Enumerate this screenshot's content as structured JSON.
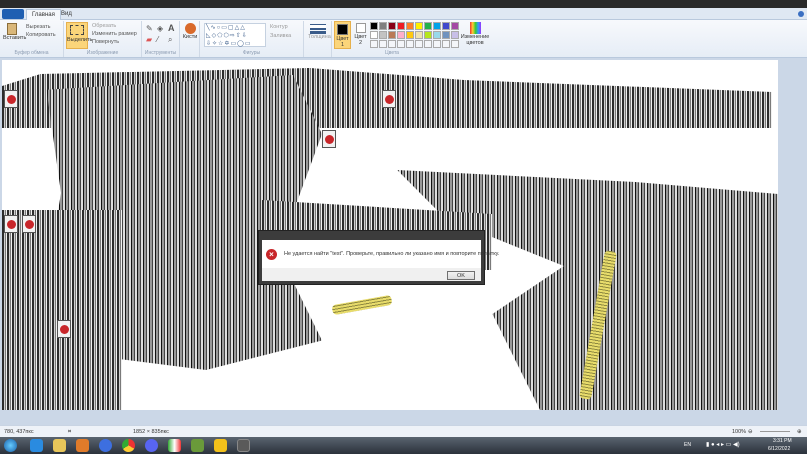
{
  "tabs": [
    "Главная",
    "Вид"
  ],
  "clipboard": {
    "paste": "Вставить",
    "cut": "Вырезать",
    "copy": "Копировать",
    "group": "Буфер обмена"
  },
  "image": {
    "select": "Выделить",
    "crop": "Обрезать",
    "resize": "Изменить размер",
    "rotate": "Повернуть",
    "group": "Изображение"
  },
  "tools": {
    "group": "Инструменты"
  },
  "brushes": {
    "label": "Кисти"
  },
  "shapes": {
    "outline": "Контур",
    "fill": "Заливка",
    "group": "Фигуры"
  },
  "size": {
    "label": "Толщина"
  },
  "colors": {
    "color1": "Цвет 1",
    "color2": "Цвет 2",
    "edit": "Изменение цветов",
    "group": "Цвета",
    "palette": [
      "#000000",
      "#7f7f7f",
      "#880015",
      "#ed1c24",
      "#ff7f27",
      "#fff200",
      "#22b14c",
      "#00a2e8",
      "#3f48cc",
      "#a349a4",
      "#ffffff",
      "#c3c3c3",
      "#b97a57",
      "#ffaec9",
      "#ffc90e",
      "#efe4b0",
      "#b5e61d",
      "#99d9ea",
      "#7092be",
      "#c8bfe7"
    ]
  },
  "dialog": {
    "message": "Не удается найти \"test\". Проверьте, правильно ли указано имя и повторите попытку.",
    "ok": "OK"
  },
  "status": {
    "cursor": "780, 437пкс",
    "size": "1852 × 835пкс",
    "zoom": "100%"
  },
  "tray": {
    "lang": "EN",
    "time": "3:31 PM",
    "date": "6/12/2022"
  }
}
